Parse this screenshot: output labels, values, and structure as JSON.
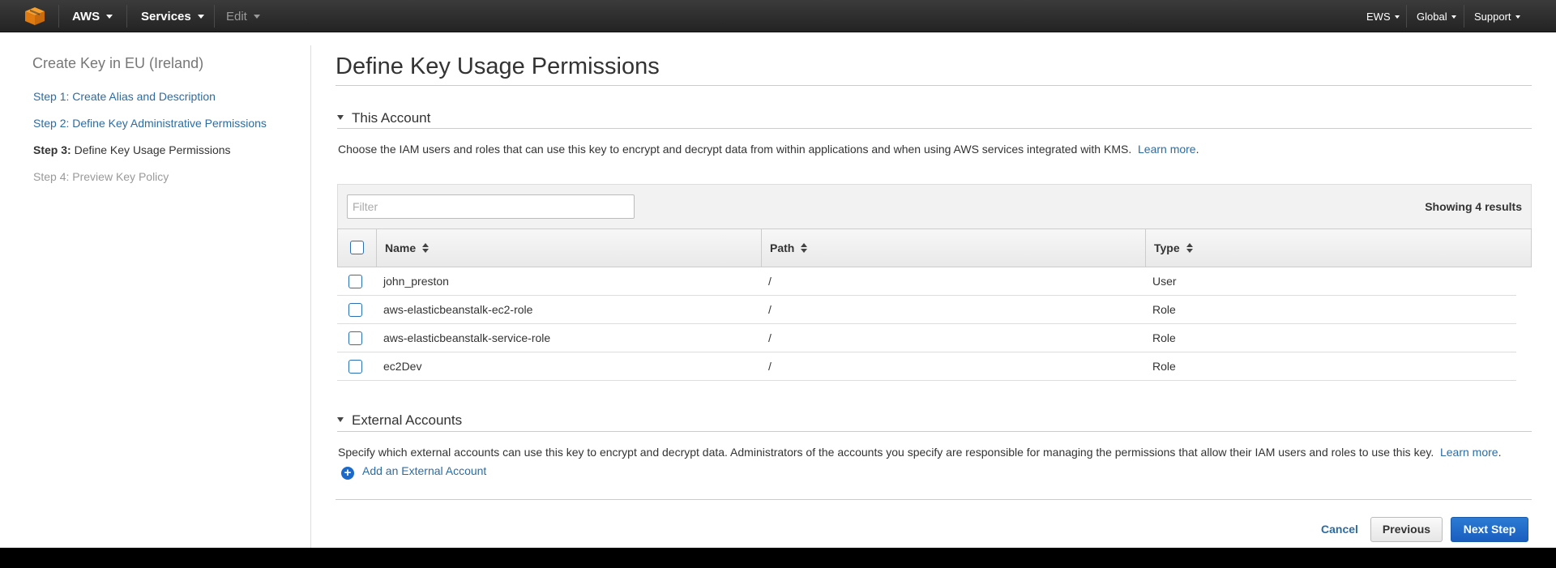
{
  "nav": {
    "brand": "AWS",
    "services": "Services",
    "edit": "Edit",
    "user": "EWS",
    "region": "Global",
    "support": "Support"
  },
  "sidebar": {
    "title": "Create Key in EU (Ireland)",
    "steps": [
      {
        "label": "Step 1: Create Alias and Description"
      },
      {
        "label": "Step 2: Define Key Administrative Permissions"
      },
      {
        "prefix": "Step 3:",
        "label": "Define Key Usage Permissions"
      },
      {
        "label": "Step 4: Preview Key Policy"
      }
    ]
  },
  "main": {
    "title": "Define Key Usage Permissions",
    "this_account": {
      "heading": "This Account",
      "description": "Choose the IAM users and roles that can use this key to encrypt and decrypt data from within applications and when using AWS services integrated with KMS.",
      "learn_more": "Learn more",
      "learn_more_suffix": "."
    },
    "table": {
      "filter_placeholder": "Filter",
      "results": "Showing 4 results",
      "columns": [
        "Name",
        "Path",
        "Type"
      ],
      "rows": [
        {
          "name": "john_preston",
          "path": "/",
          "type": "User"
        },
        {
          "name": "aws-elasticbeanstalk-ec2-role",
          "path": "/",
          "type": "Role"
        },
        {
          "name": "aws-elasticbeanstalk-service-role",
          "path": "/",
          "type": "Role"
        },
        {
          "name": "ec2Dev",
          "path": "/",
          "type": "Role"
        }
      ]
    },
    "external": {
      "heading": "External Accounts",
      "description": "Specify which external accounts can use this key to encrypt and decrypt data. Administrators of the accounts you specify are responsible for managing the permissions that allow their IAM users and roles to use this key.",
      "learn_more": "Learn more",
      "learn_more_suffix": ".",
      "add_label": "Add an External Account"
    },
    "buttons": {
      "cancel": "Cancel",
      "previous": "Previous",
      "next": "Next Step"
    }
  },
  "colors": {
    "link": "#2d6ca2",
    "primary_button": "#1a5ebf",
    "nav_background": "#232323"
  }
}
